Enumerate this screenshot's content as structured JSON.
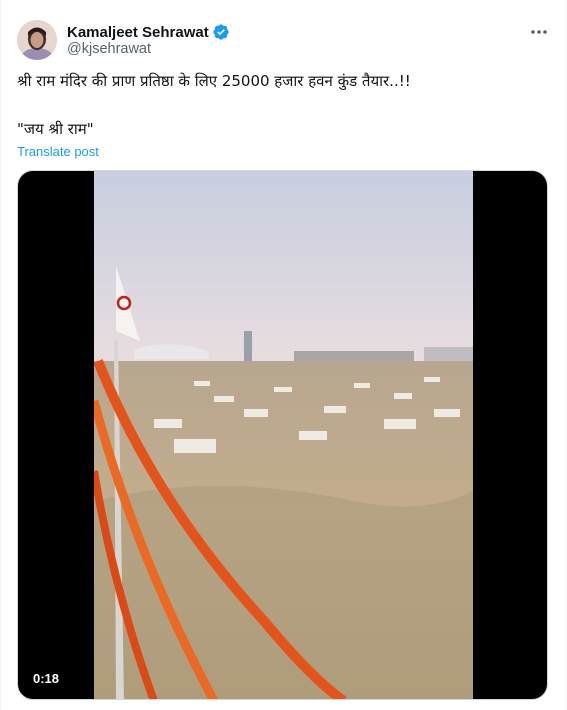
{
  "author": {
    "display_name": "Kamaljeet Sehrawat",
    "handle": "@kjsehrawat",
    "verified_color": "#1d9bf0"
  },
  "post": {
    "text": "श्री राम मंदिर की प्राण प्रतिष्ठा  के लिए 25000 हजार हवन कुंड तैयार..!!",
    "quote": "\"जय श्री राम\"",
    "translate_label": "Translate post"
  },
  "media": {
    "duration": "0:18"
  },
  "icons": {
    "verified": "verified-badge-icon",
    "more": "more-options-icon"
  },
  "colors": {
    "accent": "#1d9bf0",
    "text_primary": "#0f1419",
    "text_secondary": "#536471"
  }
}
